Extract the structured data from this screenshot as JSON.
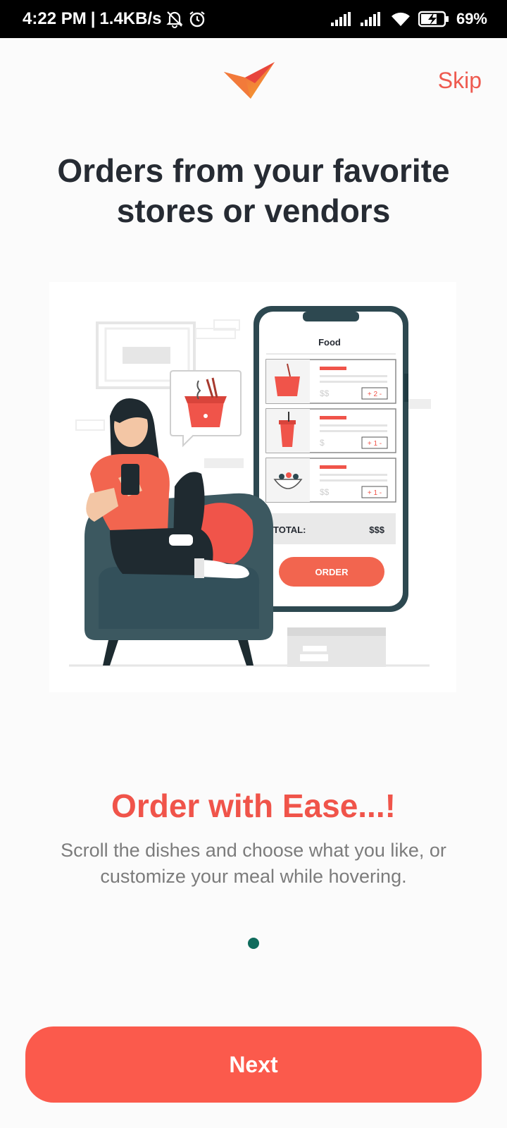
{
  "status_bar": {
    "time": "4:22 PM",
    "separator": "|",
    "network_speed": "1.4KB/s",
    "battery": "69%"
  },
  "header": {
    "skip_label": "Skip"
  },
  "title": {
    "line1": "Orders from your favorite",
    "line2": "stores or vendors"
  },
  "illustration": {
    "phone_heading": "Food",
    "items": [
      {
        "price": "$$",
        "qty": "+ 2 -"
      },
      {
        "price": "$",
        "qty": "+ 1 -"
      },
      {
        "price": "$$",
        "qty": "+ 1 -"
      }
    ],
    "total_label": "TOTAL:",
    "total_value": "$$$",
    "order_label": "ORDER"
  },
  "content": {
    "heading": "Order with Ease...!",
    "description": "Scroll the dishes and choose what you like, or customize your meal while hovering."
  },
  "pager": {
    "current": 1,
    "total": 1
  },
  "footer": {
    "next_label": "Next"
  },
  "colors": {
    "accent": "#fb5a4c",
    "heading": "#f0544a",
    "dot": "#0f6b5c",
    "title": "#262b33"
  }
}
